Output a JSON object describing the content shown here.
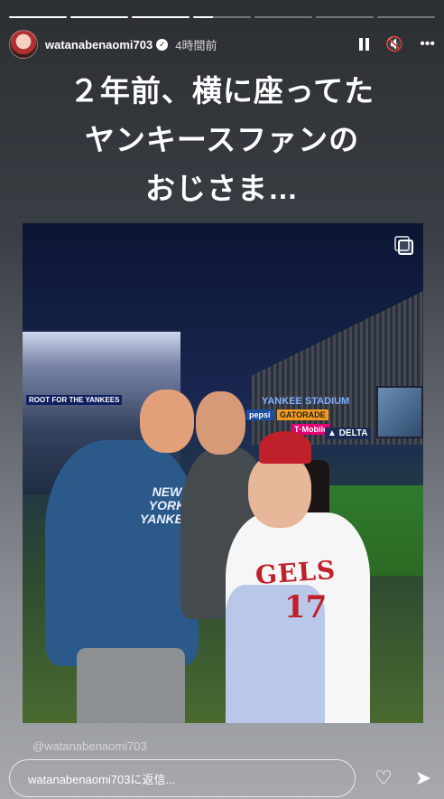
{
  "story": {
    "progress_segments": [
      1,
      1,
      1,
      0.35,
      0,
      0,
      0
    ],
    "username": "watanabenaomi703",
    "time_ago": "4時間前",
    "caption": "２年前、横に座ってた\nヤンキースファンの\nおじさま…",
    "watermark": "@watanabenaomi703"
  },
  "photo": {
    "signs": {
      "stadium": "YANKEE STADIUM",
      "pepsi": "pepsi",
      "gatorade": "GATORADE",
      "tmobile": "T·Mobile",
      "delta": "▲ DELTA",
      "root": "ROOT FOR THE YANKEES"
    },
    "tshirt_text": "NEW YORK YANKEES",
    "jersey_text": "GELS",
    "jersey_number": "17"
  },
  "footer": {
    "reply_placeholder": "watanabenaomi703に返信..."
  },
  "icons": {
    "verified": "verified-badge-icon",
    "pause": "pause-icon",
    "mute": "mute-icon",
    "more": "more-icon",
    "multi": "multi-photo-icon",
    "heart": "heart-icon",
    "send": "send-icon"
  }
}
